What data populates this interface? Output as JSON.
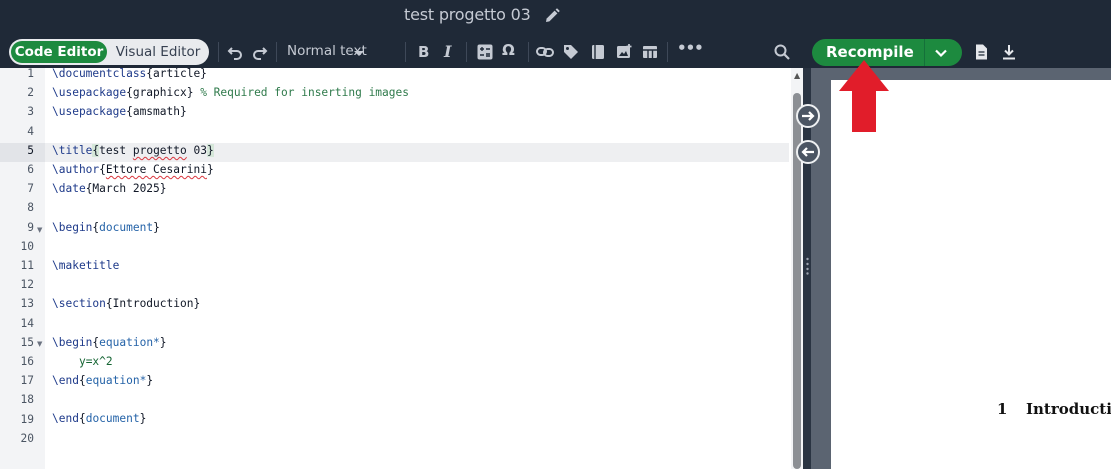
{
  "header": {
    "project_title": "test progetto 03"
  },
  "toolbar": {
    "code_editor": "Code Editor",
    "visual_editor": "Visual Editor",
    "text_style": "Normal text",
    "recompile": "Recompile",
    "omega": "Ω",
    "more": "•••"
  },
  "editor": {
    "line_numbers": [
      "1",
      "2",
      "3",
      "4",
      "5",
      "6",
      "7",
      "8",
      "9",
      "10",
      "11",
      "12",
      "13",
      "14",
      "15",
      "16",
      "17",
      "18",
      "19",
      "20"
    ],
    "active_line": 5
  },
  "preview": {
    "section_number": "1",
    "section_title": "Introducti"
  },
  "colors": {
    "accent_green": "#1d8a3f",
    "annotation_red": "#e11d2a",
    "chrome_dark": "#1f2937"
  }
}
